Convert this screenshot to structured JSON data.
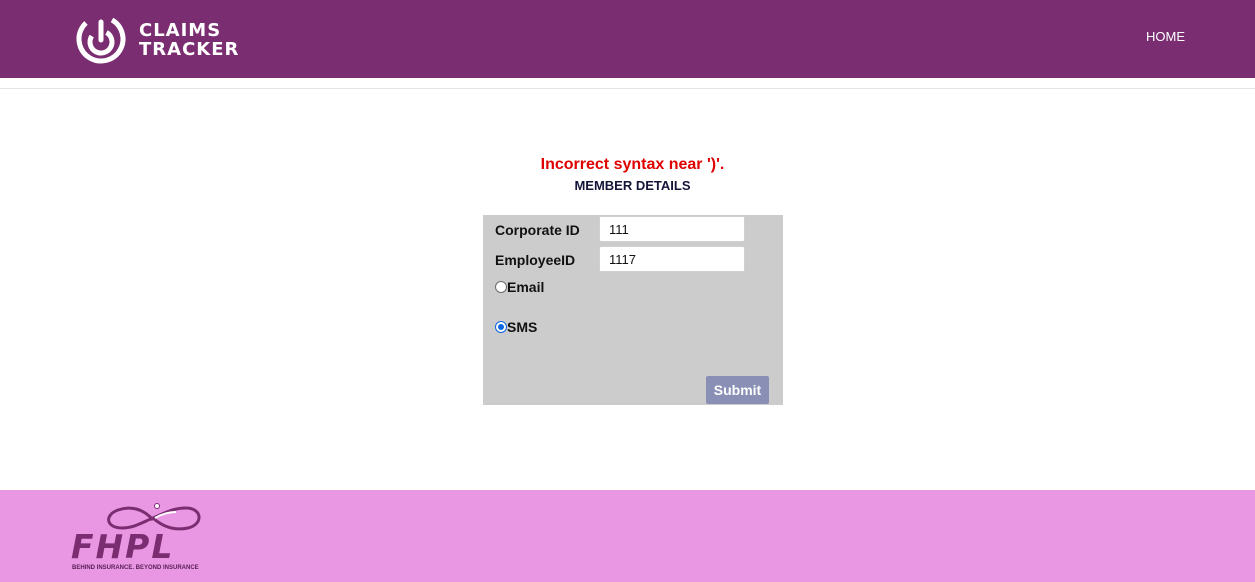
{
  "header": {
    "logo_line1": "CLAIMS",
    "logo_line2": "TRACKER",
    "nav_home": "HOME",
    "background_color": "#7b2d72"
  },
  "main": {
    "error_message": "Incorrect syntax near ')'.",
    "section_title": "MEMBER DETAILS",
    "form": {
      "corporate_id_label": "Corporate ID",
      "corporate_id_value": "111",
      "employee_id_label": "EmployeeID",
      "employee_id_value": "1117",
      "email_label": "Email",
      "email_selected": false,
      "sms_label": "SMS",
      "sms_selected": true,
      "submit_label": "Submit"
    },
    "error_color": "#e00000"
  },
  "footer": {
    "logo_text": "FHPL",
    "logo_tagline": "BEHIND INSURANCE. BEYOND INSURANCE",
    "background_color": "#e997e3"
  }
}
